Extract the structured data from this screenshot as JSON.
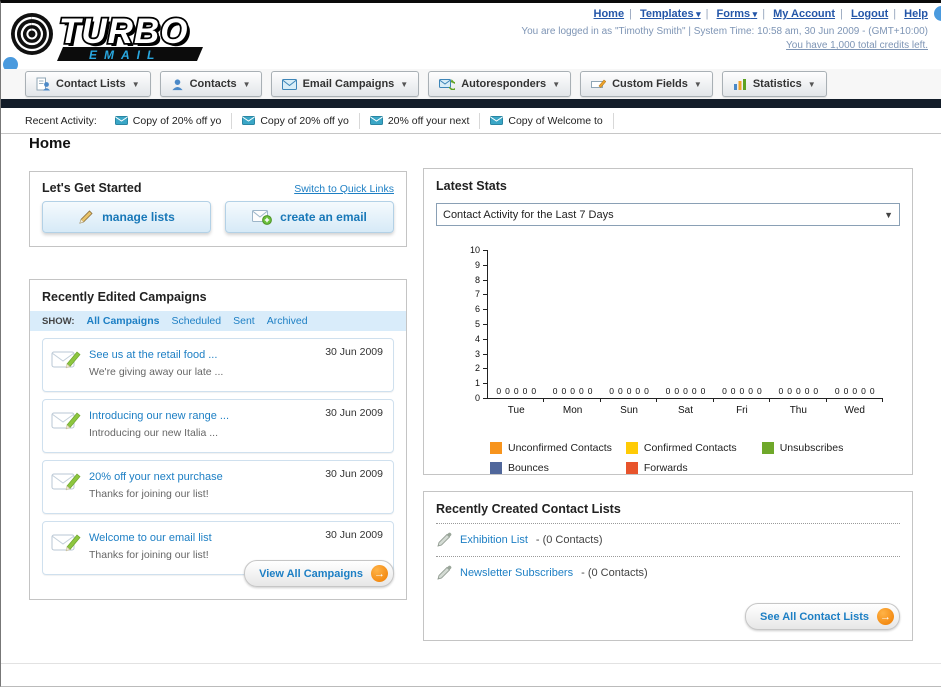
{
  "header": {
    "logo_text": "TURBO",
    "logo_sub": "EMAIL",
    "top_links": [
      {
        "label": "Home"
      },
      {
        "label": "Templates",
        "dropdown": true
      },
      {
        "label": "Forms",
        "dropdown": true
      },
      {
        "label": "My Account"
      },
      {
        "label": "Logout"
      },
      {
        "label": "Help"
      }
    ],
    "login_info": "You are logged in as \"Timothy Smith\" | System Time: 10:58 am, 30 Jun 2009 - (GMT+10:00)",
    "credits_text": "You have 1,000 total credits left."
  },
  "main_nav": [
    {
      "label": "Contact Lists"
    },
    {
      "label": "Contacts"
    },
    {
      "label": "Email Campaigns"
    },
    {
      "label": "Autoresponders"
    },
    {
      "label": "Custom Fields"
    },
    {
      "label": "Statistics"
    }
  ],
  "recent_activity": {
    "label": "Recent Activity:",
    "items": [
      "Copy of 20% off yo",
      "Copy of 20% off yo",
      "20% off your next",
      "Copy of Welcome to"
    ]
  },
  "page_title": "Home",
  "get_started": {
    "title": "Let's Get Started",
    "switch_link": "Switch to Quick Links",
    "manage_lists_label": "manage lists",
    "create_email_label": "create an email"
  },
  "campaigns": {
    "title": "Recently Edited Campaigns",
    "show_label": "SHOW:",
    "tabs": [
      "All Campaigns",
      "Scheduled",
      "Sent",
      "Archived"
    ],
    "items": [
      {
        "title": "See us at the retail food ...",
        "subtitle": "We're giving away our late ...",
        "date": "30 Jun 2009"
      },
      {
        "title": "Introducing our new range ...",
        "subtitle": "Introducing our new Italia ...",
        "date": "30 Jun 2009"
      },
      {
        "title": "20% off your next purchase",
        "subtitle": "Thanks for joining our list!",
        "date": "30 Jun 2009"
      },
      {
        "title": "Welcome to our email list",
        "subtitle": "Thanks for joining our list!",
        "date": "30 Jun 2009"
      }
    ],
    "view_all_label": "View All Campaigns",
    "arrow_glyph": "→"
  },
  "stats": {
    "title": "Latest Stats",
    "dropdown_value": "Contact Activity for the Last 7 Days"
  },
  "chart_data": {
    "type": "bar",
    "title": "Contact Activity for the Last 7 Days",
    "categories": [
      "Tue",
      "Mon",
      "Sun",
      "Sat",
      "Fri",
      "Thu",
      "Wed"
    ],
    "series": [
      {
        "name": "Unconfirmed Contacts",
        "color": "#f7941d",
        "values": [
          0,
          0,
          0,
          0,
          0,
          0,
          0
        ]
      },
      {
        "name": "Confirmed Contacts",
        "color": "#ffcb05",
        "values": [
          0,
          0,
          0,
          0,
          0,
          0,
          0
        ]
      },
      {
        "name": "Unsubscribes",
        "color": "#6fa82a",
        "values": [
          0,
          0,
          0,
          0,
          0,
          0,
          0
        ]
      },
      {
        "name": "Bounces",
        "color": "#50679b",
        "values": [
          0,
          0,
          0,
          0,
          0,
          0,
          0
        ]
      },
      {
        "name": "Forwards",
        "color": "#e8542c",
        "values": [
          0,
          0,
          0,
          0,
          0,
          0,
          0
        ]
      }
    ],
    "ylim": [
      0,
      10
    ],
    "yticks": [
      0,
      1,
      2,
      3,
      4,
      5,
      6,
      7,
      8,
      9,
      10
    ],
    "legend_position": "bottom",
    "grid": false
  },
  "contact_lists": {
    "title": "Recently Created Contact Lists",
    "items": [
      {
        "name": "Exhibition List",
        "detail": "- (0 Contacts)"
      },
      {
        "name": "Newsletter Subscribers",
        "detail": "- (0 Contacts)"
      }
    ],
    "see_all_label": "See All Contact Lists",
    "arrow_glyph": "→"
  }
}
